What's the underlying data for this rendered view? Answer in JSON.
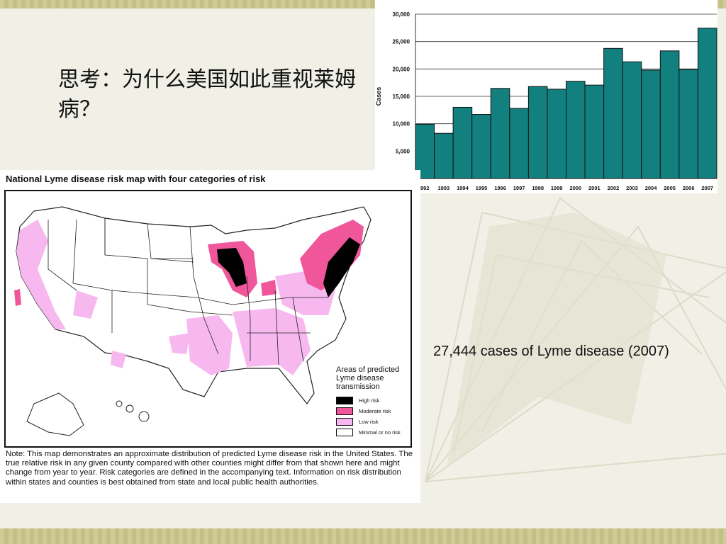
{
  "slide": {
    "title": "思考：为什么美国如此重视莱姆病？",
    "caption": "27,444 cases of Lyme disease (2007)"
  },
  "map": {
    "title": "National Lyme disease risk map with four categories of risk",
    "legend_title": "Areas of predicted Lyme disease transmission",
    "legend": [
      {
        "label": "High risk",
        "color": "#000000"
      },
      {
        "label": "Moderate  risk",
        "color": "#f0569a"
      },
      {
        "label": "Low  risk",
        "color": "#f7b8f0"
      },
      {
        "label": "Minimal or no risk",
        "color": "#ffffff"
      }
    ],
    "note": "Note: This map demonstrates an approximate distribution of predicted Lyme disease risk in the United States. The true relative risk in any given county compared with other counties might differ from that shown here and might change from year to year. Risk categories are defined in the accompanying text. Information on risk distribution within states and counties is best obtained from state and local public health authorities."
  },
  "chart_data": {
    "type": "bar",
    "categories": [
      "992",
      "1993",
      "1994",
      "1995",
      "1996",
      "1997",
      "1998",
      "1999",
      "2000",
      "2001",
      "2002",
      "2003",
      "2004",
      "2005",
      "2006",
      "2007"
    ],
    "values": [
      9900,
      8250,
      13000,
      11700,
      16450,
      12800,
      16800,
      16300,
      17750,
      17050,
      23750,
      21300,
      19800,
      23300,
      19900,
      27450
    ],
    "ylabel": "Cases",
    "yticks": [
      "5,000",
      "10,000",
      "15,000",
      "20,000",
      "25,000",
      "30,000"
    ],
    "ylim": [
      0,
      30000
    ],
    "bar_color": "#138080",
    "grid": true
  }
}
